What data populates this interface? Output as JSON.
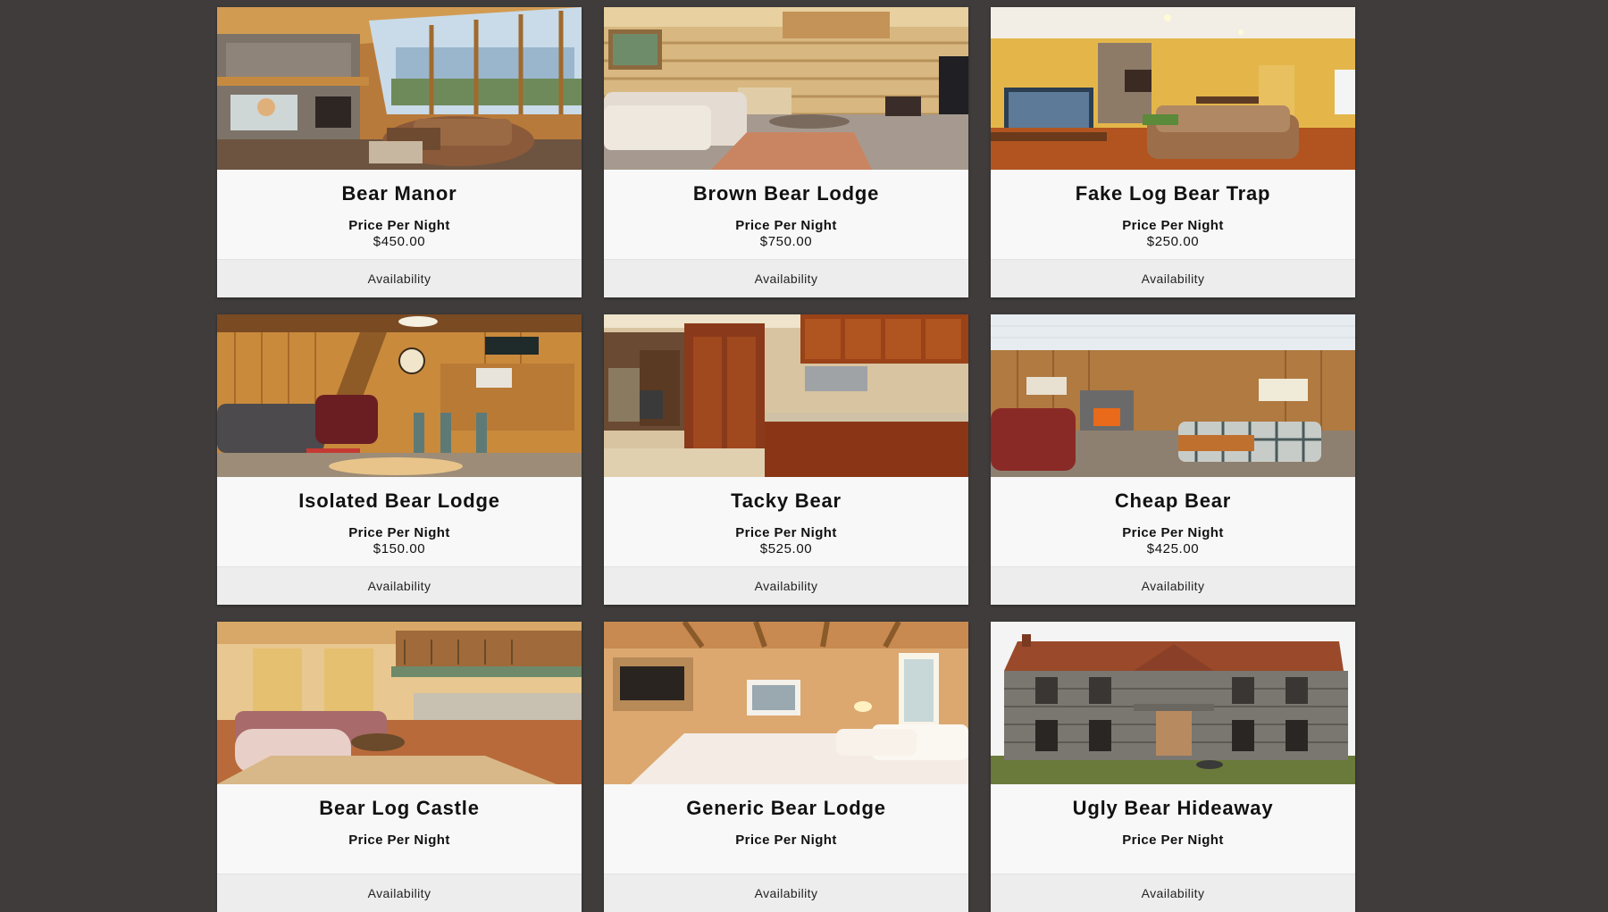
{
  "listings": [
    {
      "name": "Bear Manor",
      "price_label": "Price Per Night",
      "price": "$450.00",
      "availability_label": "Availability",
      "photo": "great-room-with-fireplace-and-windows"
    },
    {
      "name": "Brown Bear Lodge",
      "price_label": "Price Per Night",
      "price": "$750.00",
      "availability_label": "Availability",
      "photo": "log-cabin-living-room-with-loft"
    },
    {
      "name": "Fake Log Bear Trap",
      "price_label": "Price Per Night",
      "price": "$250.00",
      "availability_label": "Availability",
      "photo": "living-room-with-tv-and-stone-fireplace"
    },
    {
      "name": "Isolated Bear Lodge",
      "price_label": "Price Per Night",
      "price": "$150.00",
      "availability_label": "Availability",
      "photo": "wood-paneled-bar-and-lounge"
    },
    {
      "name": "Tacky Bear",
      "price_label": "Price Per Night",
      "price": "$525.00",
      "availability_label": "Availability",
      "photo": "wooden-cabinet-kitchen"
    },
    {
      "name": "Cheap Bear",
      "price_label": "Price Per Night",
      "price": "$425.00",
      "availability_label": "Availability",
      "photo": "plaid-couch-living-room"
    },
    {
      "name": "Bear Log Castle",
      "price_label": "Price Per Night",
      "price": "",
      "availability_label": "Availability",
      "photo": "loft-living-room-with-sectional"
    },
    {
      "name": "Generic Bear Lodge",
      "price_label": "Price Per Night",
      "price": "",
      "availability_label": "Availability",
      "photo": "bedroom-with-beams"
    },
    {
      "name": "Ugly Bear Hideaway",
      "price_label": "Price Per Night",
      "price": "",
      "availability_label": "Availability",
      "photo": "abandoned-wooden-house"
    }
  ],
  "colors": {
    "page_background": "#3f3c3b",
    "card_background": "#f8f8f8",
    "availability_bar": "#ededed"
  }
}
